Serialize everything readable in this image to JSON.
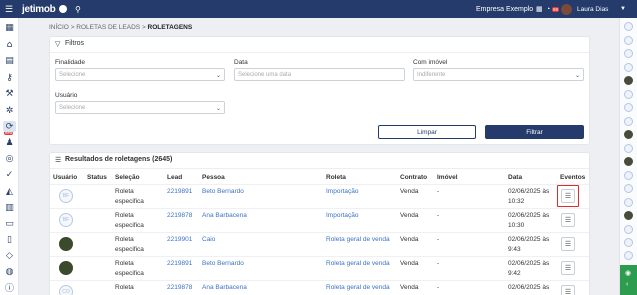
{
  "topbar": {
    "logo": "jetimob",
    "company": "Empresa Exemplo",
    "notif_count": "99",
    "user_name": "Laura Dias"
  },
  "breadcrumb": {
    "items": [
      "INÍCIO",
      "ROLETAS DE LEADS",
      "ROLETAGENS"
    ],
    "separator": ">"
  },
  "filters": {
    "title": "Filtros",
    "finalidade": {
      "label": "Finalidade",
      "placeholder": "Selecione"
    },
    "data": {
      "label": "Data",
      "placeholder": "Selecione uma data"
    },
    "com_imovel": {
      "label": "Com imóvel",
      "value": "Indiferente"
    },
    "usuario": {
      "label": "Usuário",
      "placeholder": "Selecione"
    },
    "clear_label": "Limpar",
    "filter_label": "Filtrar"
  },
  "results": {
    "title": "Resultados de roletagens (2645)",
    "columns": [
      "Usuário",
      "Status",
      "Seleção",
      "Lead",
      "Pessoa",
      "Roleta",
      "Contrato",
      "Imóvel",
      "Data",
      "Eventos"
    ],
    "rows": [
      {
        "avatar": "BF",
        "selecao_1": "Roleta",
        "selecao_2": "especifica",
        "lead": "2219891",
        "pessoa": "Beto Bernardo",
        "roleta": "Importação",
        "contrato": "Venda",
        "imovel": "-",
        "data_1": "02/06/2025 às",
        "data_2": "10:32"
      },
      {
        "avatar": "BF",
        "selecao_1": "Roleta",
        "selecao_2": "especifica",
        "lead": "2219878",
        "pessoa": "Ana Barbacena",
        "roleta": "Importação",
        "contrato": "Venda",
        "imovel": "-",
        "data_1": "02/06/2025 às",
        "data_2": "10:30"
      },
      {
        "avatar": "photo",
        "selecao_1": "Roleta",
        "selecao_2": "especifica",
        "lead": "2219901",
        "pessoa": "Caio",
        "roleta": "Roleta geral de venda",
        "contrato": "Venda",
        "imovel": "-",
        "data_1": "02/06/2025 às",
        "data_2": "9:43"
      },
      {
        "avatar": "photo",
        "selecao_1": "Roleta",
        "selecao_2": "especifica",
        "lead": "2219891",
        "pessoa": "Beto Bernardo",
        "roleta": "Roleta geral de venda",
        "contrato": "Venda",
        "imovel": "-",
        "data_1": "02/06/2025 às",
        "data_2": "9:42"
      },
      {
        "avatar": "CO",
        "selecao_1": "Roleta",
        "selecao_2": "",
        "lead": "2219878",
        "pessoa": "Ana Barbacena",
        "roleta": "Roleta geral de venda",
        "contrato": "Venda",
        "imovel": "-",
        "data_1": "02/06/2025 às",
        "data_2": ""
      }
    ]
  },
  "colors": {
    "primary": "#243b6b",
    "link": "#3c72c4",
    "highlight": "#e02b2b",
    "green": "#2e9c4f"
  }
}
